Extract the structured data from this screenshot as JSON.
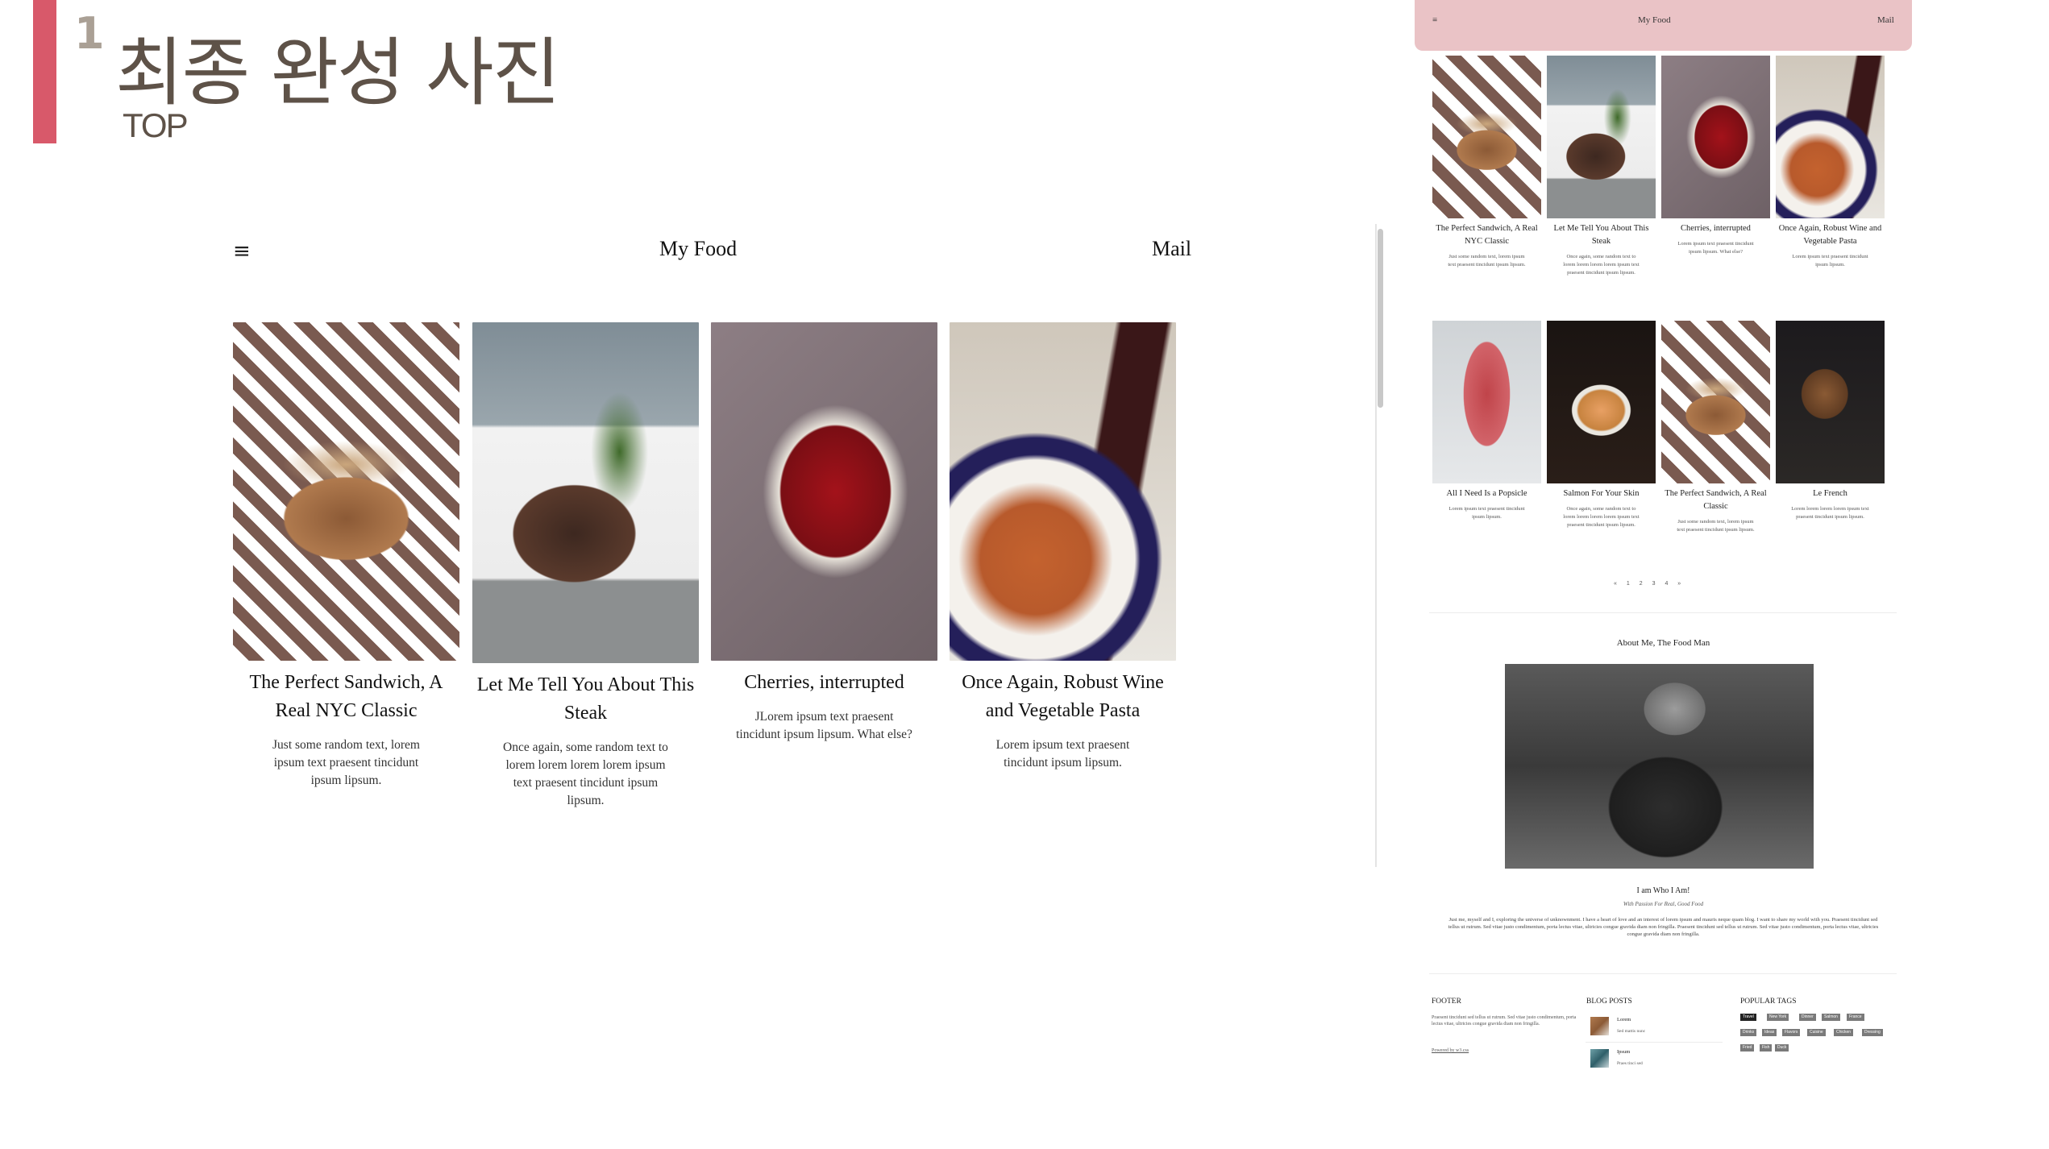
{
  "slide": {
    "number": "1",
    "title": "최종 완성 사진",
    "subtitle": "TOP",
    "accent_color": "#d8596a"
  },
  "large_preview": {
    "menu_icon": "hamburger-icon",
    "menu_glyph": "≡",
    "logo": "My Food",
    "mail_link": "Mail",
    "posts": [
      {
        "title": "The Perfect Sandwich, A Real NYC Classic",
        "text": "Just some random text, lorem ipsum text praesent tincidunt ipsum lipsum."
      },
      {
        "title": "Let Me Tell You About This Steak",
        "text": "Once again, some random text to lorem lorem lorem lorem ipsum text praesent tincidunt ipsum lipsum."
      },
      {
        "title": "Cherries, interrupted",
        "text": "JLorem ipsum text praesent tincidunt ipsum lipsum. What else?"
      },
      {
        "title": "Once Again, Robust Wine and Vegetable Pasta",
        "text": "Lorem ipsum text praesent tincidunt ipsum lipsum."
      }
    ]
  },
  "small_preview": {
    "nav": {
      "menu_glyph": "≡",
      "logo": "My Food",
      "mail_link": "Mail",
      "background": "#eac3c6"
    },
    "posts": [
      {
        "title": "The Perfect Sandwich, A Real NYC Classic",
        "text": "Just some random text, lorem ipsum text praesent tincidunt ipsum lipsum."
      },
      {
        "title": "Let Me Tell You About This Steak",
        "text": "Once again, some random text to lorem lorem lorem lorem ipsum text praesent tincidunt ipsum lipsum."
      },
      {
        "title": "Cherries, interrupted",
        "text": "Lorem ipsum text praesent tincidunt ipsum lipsum. What else?"
      },
      {
        "title": "Once Again, Robust Wine and Vegetable Pasta",
        "text": "Lorem ipsum text praesent tincidunt ipsum lipsum."
      },
      {
        "title": "All I Need Is a Popsicle",
        "text": "Lorem ipsum text praesent tincidunt ipsum lipsum."
      },
      {
        "title": "Salmon For Your Skin",
        "text": "Once again, some random text to lorem lorem lorem lorem ipsum text praesent tincidunt ipsum lipsum."
      },
      {
        "title": "The Perfect Sandwich, A Real Classic",
        "text": "Just some random text, lorem ipsum text praesent tincidunt ipsum lipsum."
      },
      {
        "title": "Le French",
        "text": "Lorem lorem lorem lorem ipsum text praesent tincidunt ipsum lipsum."
      }
    ],
    "pagination": {
      "prev": "«",
      "pages": [
        "1",
        "2",
        "3",
        "4"
      ],
      "next": "»"
    },
    "about": {
      "heading": "About Me, The Food Man",
      "name": "I am Who I Am!",
      "tagline": "With Passion For Real, Good Food",
      "bio": "Just me, myself and I, exploring the universe of unknownment. I have a heart of love and an interest of lorem ipsum and mauris neque quam blog. I want to share my world with you. Praesent tincidunt sed tellus ut rutrum. Sed vitae justo condimentum, porta lectus vitae, ultricies congue gravida diam non fringilla. Praesent tincidunt sed tellus ut rutrum. Sed vitae justo condimentum, porta lectus vitae, ultricies congue gravida diam non fringilla."
    },
    "footer": {
      "heading": "FOOTER",
      "text": "Praesent tincidunt sed tellus ut rutrum. Sed vitae justo condimentum, porta lectus vitae, ultricies congue gravida diam non fringilla.",
      "powered_by": "Powered by w3.css"
    },
    "blog_posts": {
      "heading": "BLOG POSTS",
      "items": [
        {
          "title": "Lorem",
          "subtitle": "Sed mattis nunc"
        },
        {
          "title": "Ipsum",
          "subtitle": "Praes tinci sed"
        }
      ]
    },
    "popular_tags": {
      "heading": "POPULAR TAGS",
      "tags": [
        "Travel",
        "New York",
        "Dinner",
        "Salmon",
        "France",
        "Drinks",
        "Ideas",
        "Flavors",
        "Cuisine",
        "Chicken",
        "Dressing",
        "Fried",
        "Fish",
        "Duck"
      ]
    }
  }
}
